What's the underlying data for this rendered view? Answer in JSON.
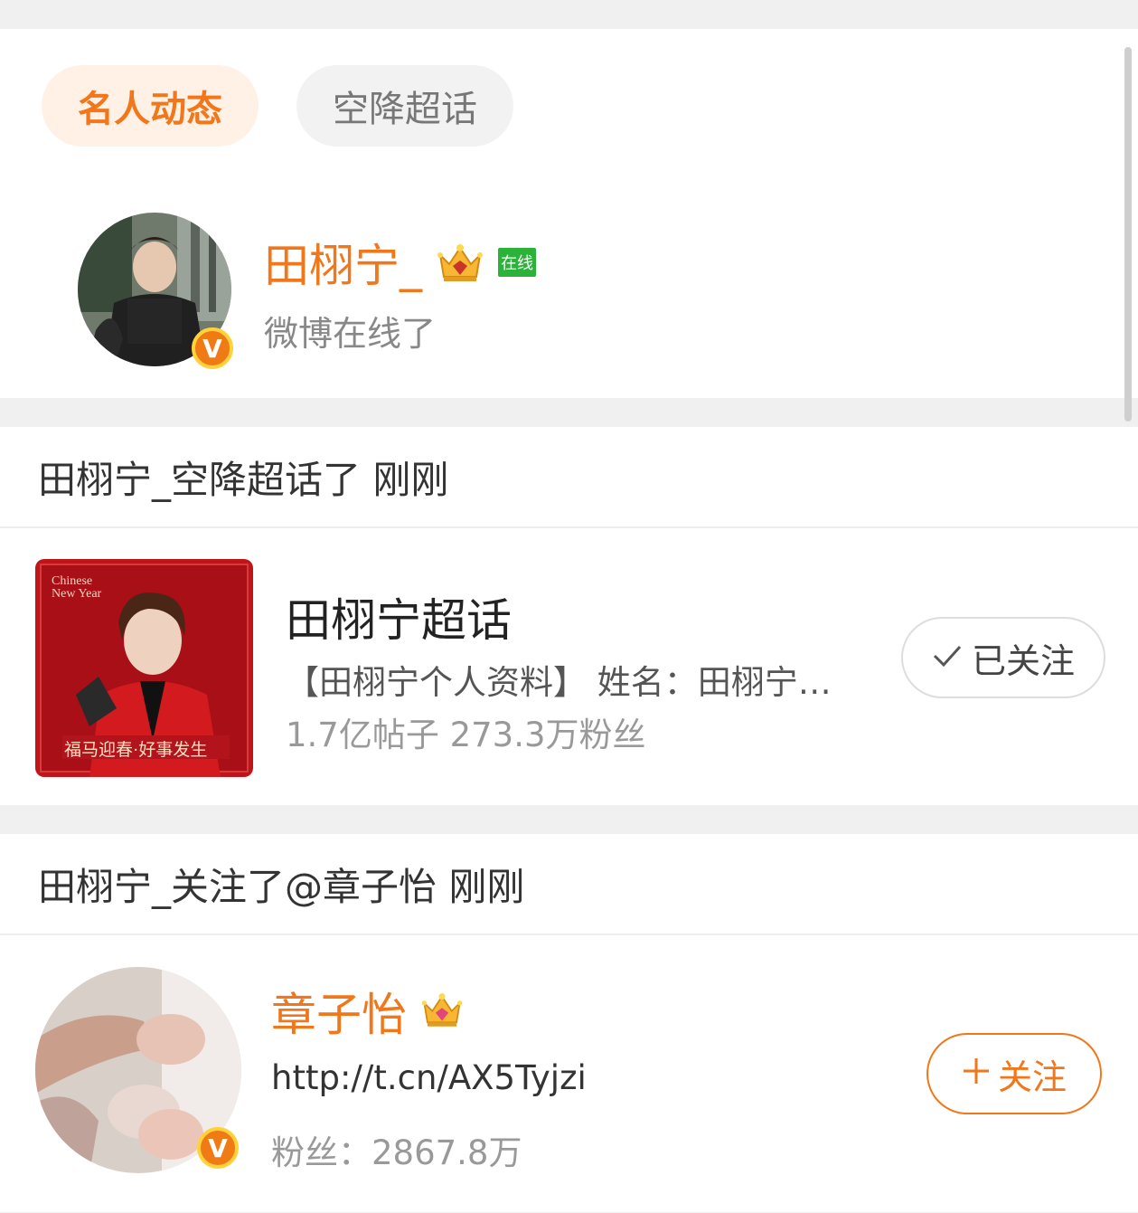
{
  "tabs": [
    {
      "label": "名人动态"
    },
    {
      "label": "空降超话"
    }
  ],
  "celebrity": {
    "name": "田栩宁_",
    "online_badge": "在线",
    "status": "微博在线了",
    "verified_badge": "V"
  },
  "activity1": {
    "header": "田栩宁_空降超话了 刚刚",
    "topic": {
      "name": "田栩宁超话",
      "description": "【田栩宁个人资料】 姓名：田栩宁…",
      "stats": "1.7亿帖子  273.3万粉丝",
      "thumbnail_text_top": "Chinese New Year",
      "thumbnail_text_bottom": "福马迎春·好事发生",
      "button_label": "已关注"
    }
  },
  "activity2": {
    "header": "田栩宁_关注了@章子怡 刚刚",
    "user": {
      "name": "章子怡",
      "link": "http://t.cn/AX5Tyjzi",
      "fans": "粉丝：2867.8万",
      "verified_badge": "V",
      "button_label": "关注"
    }
  },
  "colors": {
    "accent": "#f2771a",
    "online_green": "#2bb239"
  }
}
